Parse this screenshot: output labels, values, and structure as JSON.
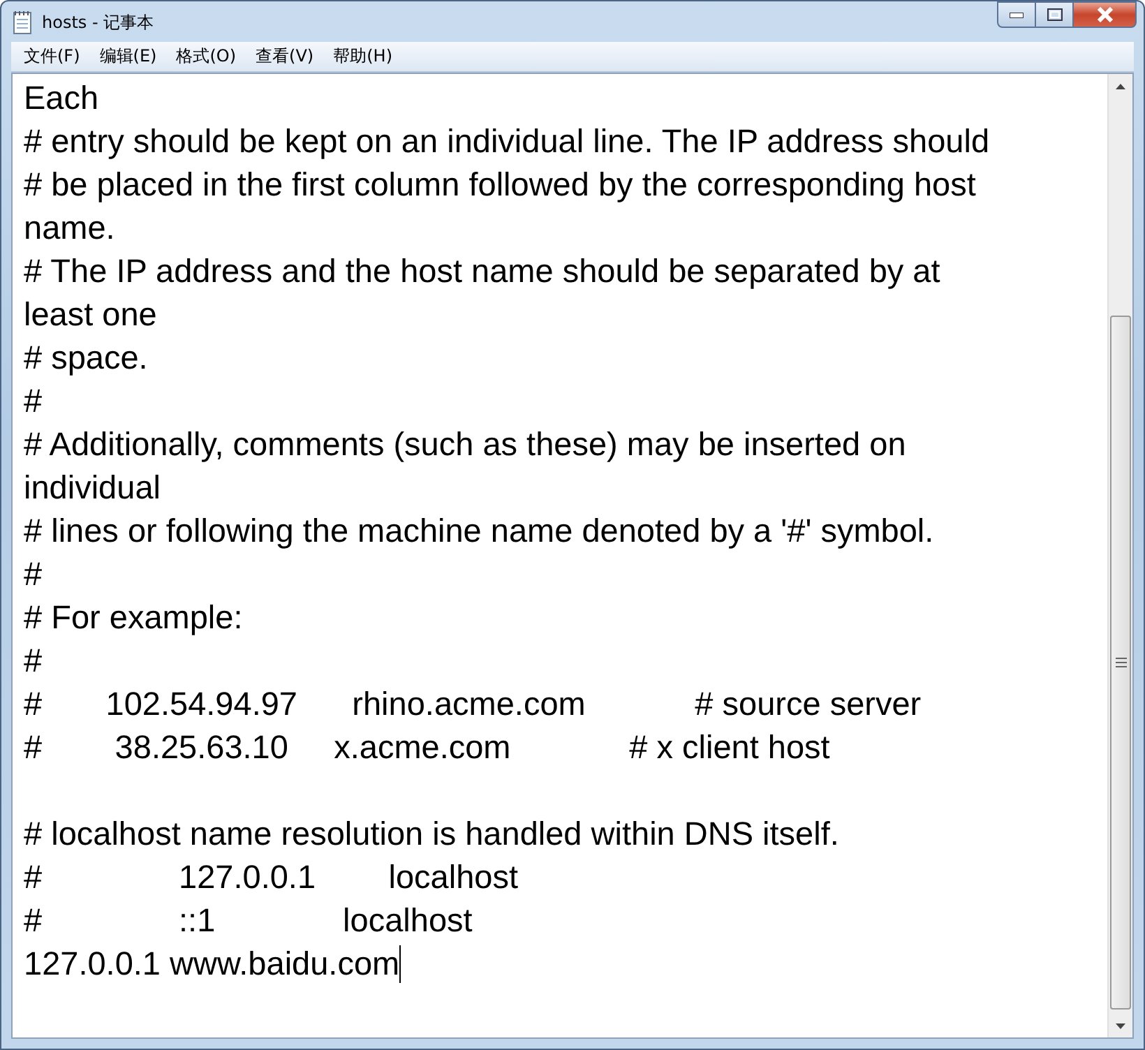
{
  "window": {
    "title": "hosts - 记事本"
  },
  "menu": [
    {
      "label": "文件(F)"
    },
    {
      "label": "编辑(E)"
    },
    {
      "label": "格式(O)"
    },
    {
      "label": "查看(V)"
    },
    {
      "label": "帮助(H)"
    }
  ],
  "editor": {
    "blocks": [
      [
        "Each",
        "# entry should be kept on an individual line. The IP address should",
        "# be placed in the first column followed by the corresponding host",
        "name.",
        "# The IP address and the host name should be separated by at",
        "least one",
        "# space.",
        "#",
        "# Additionally, comments (such as these) may be inserted on",
        "individual",
        "# lines or following the machine name denoted by a '#' symbol.",
        "#",
        "# For example:",
        "#",
        "#       102.54.94.97      rhino.acme.com            # source server",
        "#        38.25.63.10     x.acme.com             # x client host"
      ],
      [
        "# localhost name resolution is handled within DNS itself.",
        "#               127.0.0.1        localhost",
        "#               ::1              localhost",
        "127.0.0.1 www.baidu.com"
      ]
    ]
  }
}
